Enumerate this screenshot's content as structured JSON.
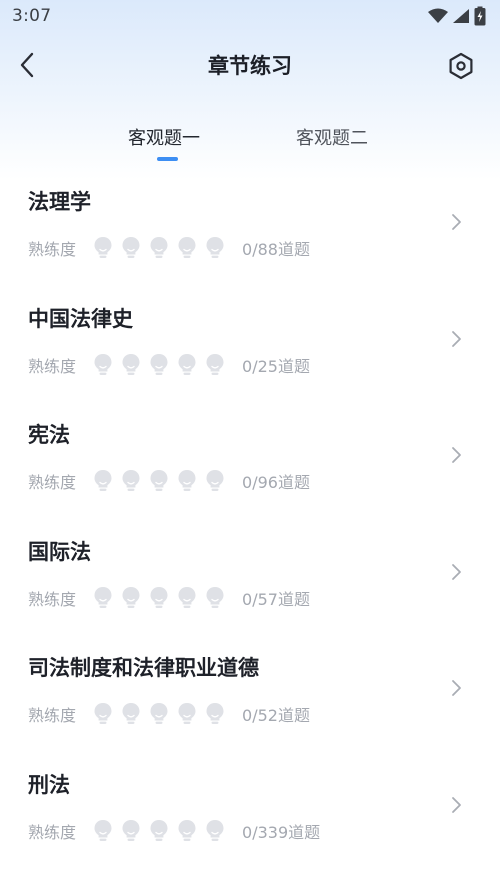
{
  "status_bar": {
    "time": "3:07",
    "icons": [
      "wifi-icon",
      "signal-icon",
      "battery-charging-icon"
    ]
  },
  "header": {
    "title": "章节练习",
    "back_icon": "chevron-left-icon",
    "settings_icon": "hexagon-settings-icon"
  },
  "tabs": [
    {
      "label": "客观题一",
      "active": true
    },
    {
      "label": "客观题二",
      "active": false
    }
  ],
  "accent_color": "#3d8ef3",
  "chapters": [
    {
      "title": "法理学",
      "mastery_label": "熟练度",
      "mastery_level": 0,
      "mastery_max": 5,
      "progress": "0/88道题"
    },
    {
      "title": "中国法律史",
      "mastery_label": "熟练度",
      "mastery_level": 0,
      "mastery_max": 5,
      "progress": "0/25道题"
    },
    {
      "title": "宪法",
      "mastery_label": "熟练度",
      "mastery_level": 0,
      "mastery_max": 5,
      "progress": "0/96道题"
    },
    {
      "title": "国际法",
      "mastery_label": "熟练度",
      "mastery_level": 0,
      "mastery_max": 5,
      "progress": "0/57道题"
    },
    {
      "title": "司法制度和法律职业道德",
      "mastery_label": "熟练度",
      "mastery_level": 0,
      "mastery_max": 5,
      "progress": "0/52道题"
    },
    {
      "title": "刑法",
      "mastery_label": "熟练度",
      "mastery_level": 0,
      "mastery_max": 5,
      "progress": "0/339道题"
    }
  ]
}
